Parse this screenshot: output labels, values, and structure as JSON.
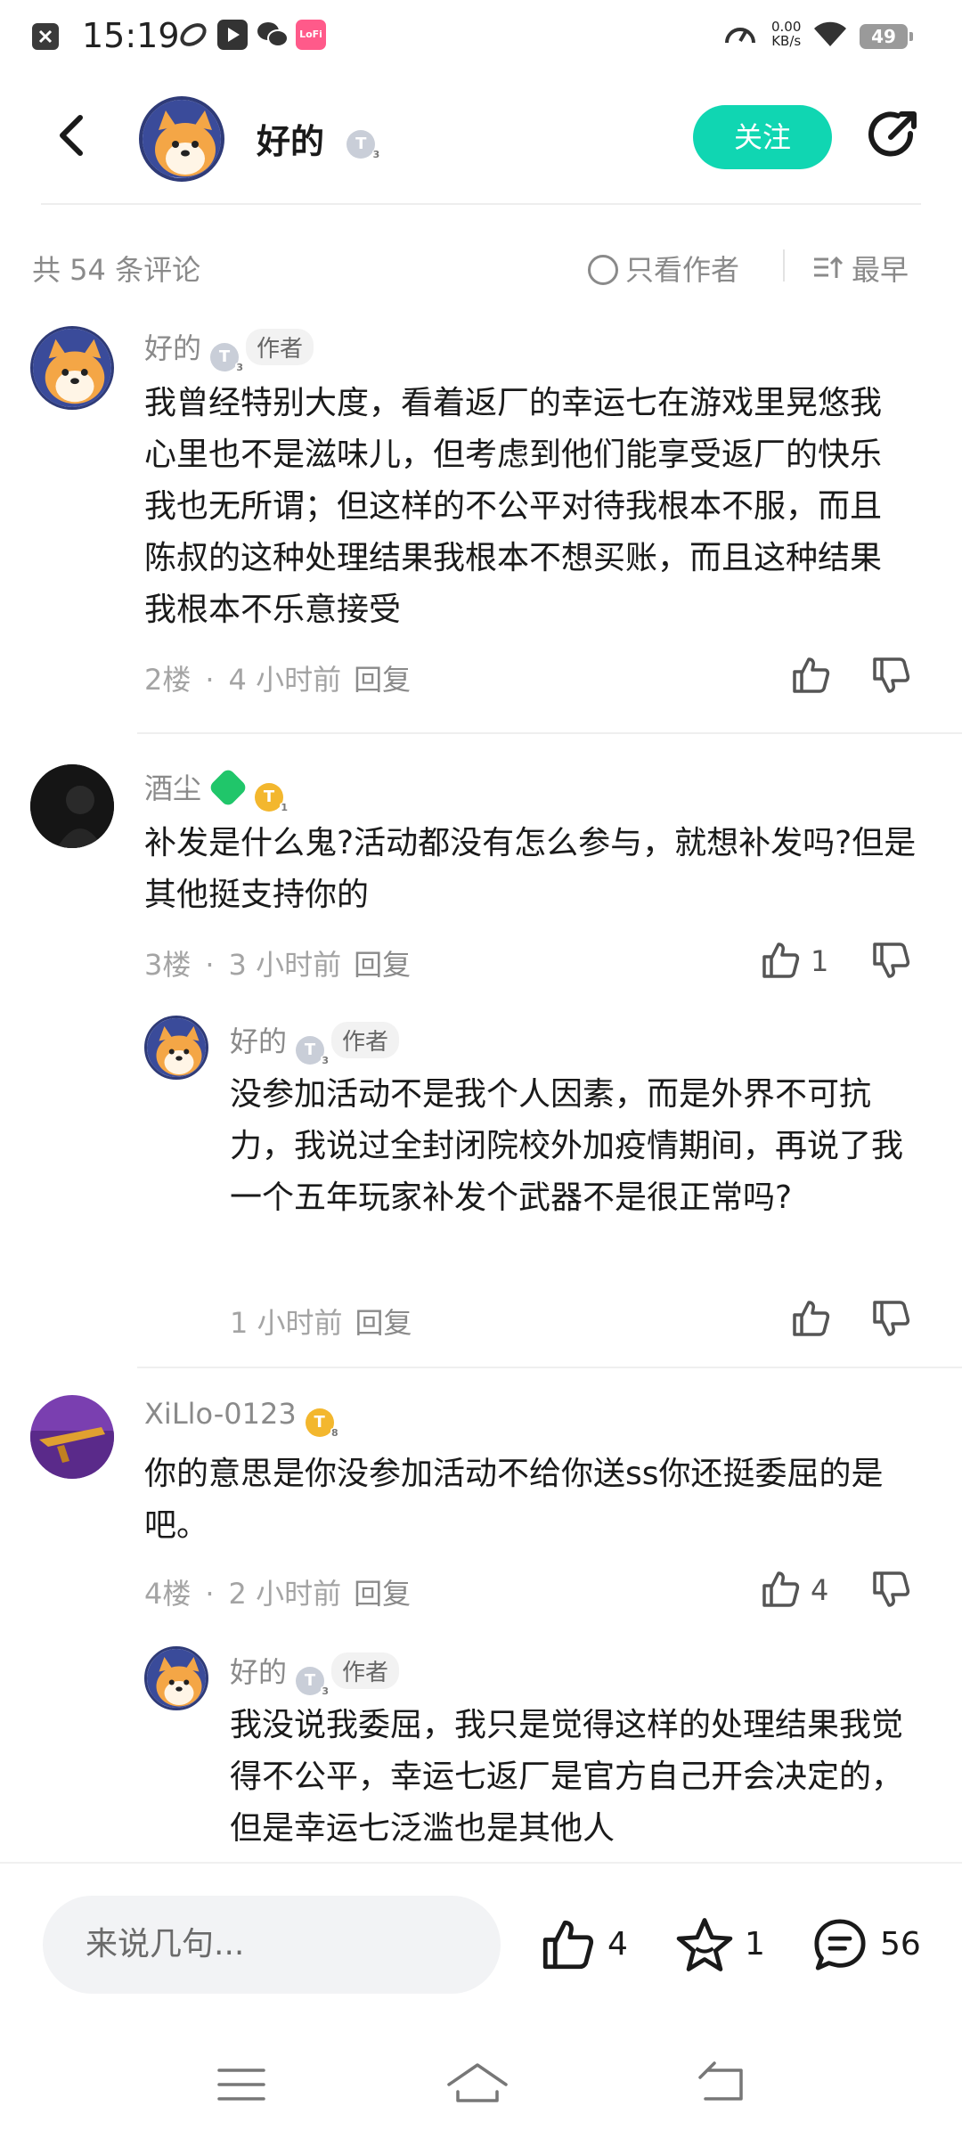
{
  "status_bar": {
    "time": "15:19",
    "speed_value": "0.00",
    "speed_unit": "KB/s",
    "battery": "49",
    "app_badge": "LoFi"
  },
  "header": {
    "title": "好的",
    "level_badge": "T",
    "level_num": "3",
    "follow_label": "关注"
  },
  "comments_bar": {
    "count_text": "共 54 条评论",
    "only_author_label": "只看作者",
    "sort_label": "最早"
  },
  "comments": [
    {
      "name": "好的",
      "badge": "T",
      "badge_num": "3",
      "author_tag": "作者",
      "text": "我曾经特别大度，看着返厂的幸运七在游戏里晃悠我心里也不是滋味儿，但考虑到他们能享受返厂的快乐我也无所谓；但这样的不公平对待我根本不服，而且陈叔的这种处理结果我根本不想买账，而且这种结果我根本不乐意接受",
      "floor": "2楼",
      "time": "4 小时前",
      "reply": "回复",
      "likes": ""
    },
    {
      "name": "酒尘",
      "badge": "T",
      "badge_num": "1",
      "text": "补发是什么鬼?活动都没有怎么参与，就想补发吗?但是其他挺支持你的",
      "floor": "3楼",
      "time": "3 小时前",
      "reply": "回复",
      "likes": "1",
      "replies": [
        {
          "name": "好的",
          "badge": "T",
          "badge_num": "3",
          "author_tag": "作者",
          "text": "没参加活动不是我个人因素，而是外界不可抗力，我说过全封闭院校外加疫情期间，再说了我一个五年玩家补发个武器不是很正常吗?",
          "time": "1 小时前",
          "reply": "回复"
        }
      ]
    },
    {
      "name": "XiLlo-0123",
      "badge": "T",
      "badge_num": "8",
      "text": "你的意思是你没参加活动不给你送ss你还挺委屈的是吧。",
      "floor": "4楼",
      "time": "2 小时前",
      "reply": "回复",
      "likes": "4",
      "replies": [
        {
          "name": "好的",
          "badge": "T",
          "badge_num": "3",
          "author_tag": "作者",
          "text": "我没说我委屈，我只是觉得这样的处理结果我觉得不公平，幸运七返厂是官方自己开会决定的，但是幸运七泛滥也是其他人"
        }
      ]
    }
  ],
  "bottom_bar": {
    "input_placeholder": "来说几句...",
    "likes": "4",
    "favorites": "1",
    "comments": "56"
  },
  "colors": {
    "accent": "#10d6b2",
    "text_primary": "#1a1a1a",
    "text_secondary": "#8a8a8a"
  }
}
